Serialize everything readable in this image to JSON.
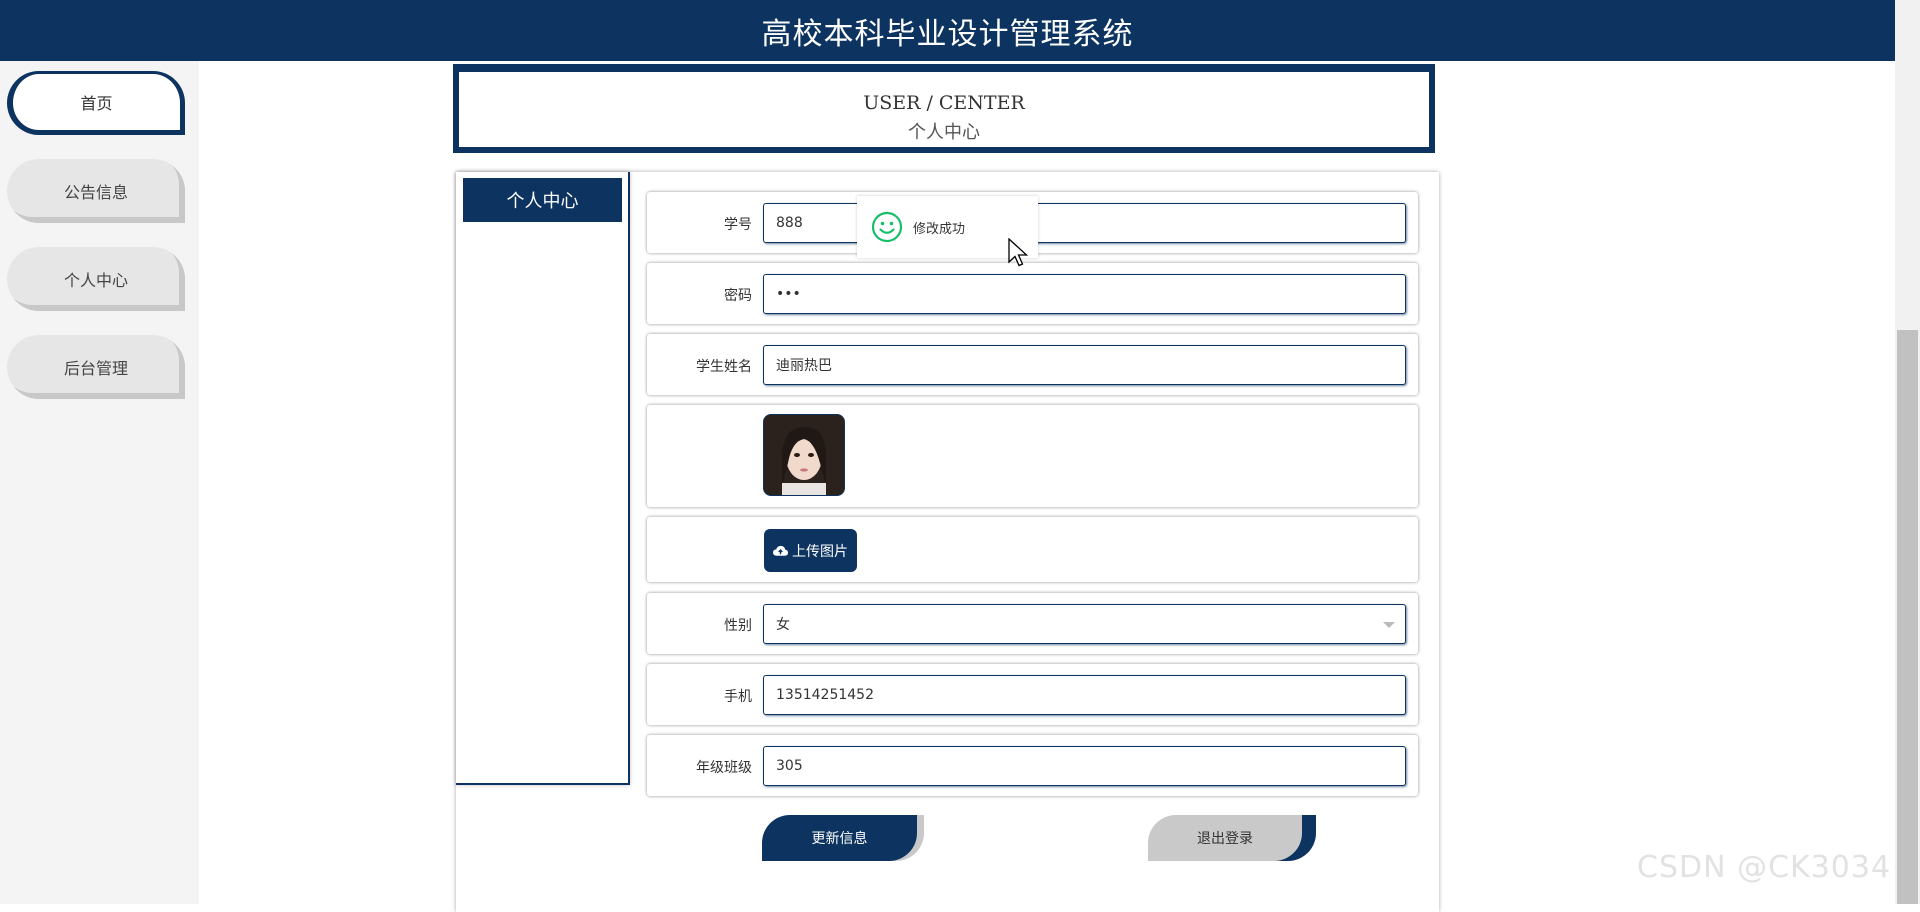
{
  "header": {
    "title": "高校本科毕业设计管理系统"
  },
  "sidebar": {
    "items": [
      {
        "label": "首页",
        "active": true
      },
      {
        "label": "公告信息",
        "active": false
      },
      {
        "label": "个人中心",
        "active": false
      },
      {
        "label": "后台管理",
        "active": false
      }
    ]
  },
  "banner": {
    "en": "USER / CENTER",
    "cn": "个人中心"
  },
  "subnav": {
    "title": "个人中心"
  },
  "form": {
    "student_id_label": "学号",
    "student_id_value": "888",
    "password_label": "密码",
    "password_value": "•••",
    "name_label": "学生姓名",
    "name_value": "迪丽热巴",
    "upload_label": "上传图片",
    "gender_label": "性别",
    "gender_value": "女",
    "phone_label": "手机",
    "phone_value": "13514251452",
    "class_label": "年级班级",
    "class_value": "305"
  },
  "toast": {
    "message": "修改成功",
    "icon": "smile-icon"
  },
  "actions": {
    "update_label": "更新信息",
    "logout_label": "退出登录"
  },
  "watermark": "CSDN @CK3034",
  "colors": {
    "primary": "#0d3460",
    "secondary": "#c9c9c9",
    "success": "#19be6b"
  }
}
